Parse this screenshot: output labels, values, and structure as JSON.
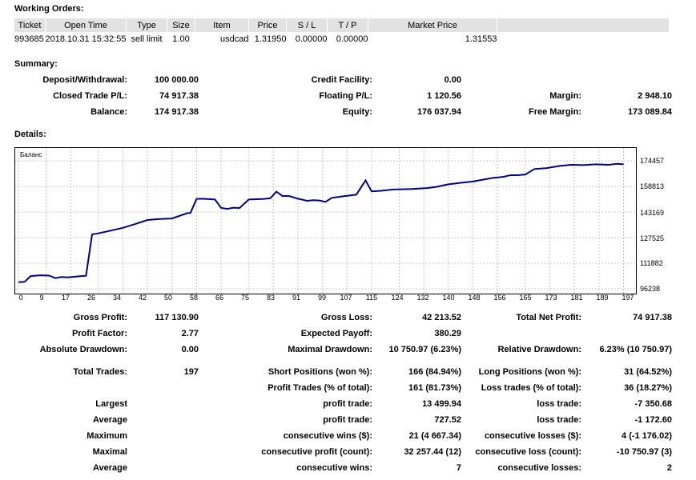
{
  "working_orders": {
    "title": "Working Orders:",
    "headers": [
      "Ticket",
      "Open Time",
      "Type",
      "Size",
      "Item",
      "Price",
      "S / L",
      "T / P",
      "Market Price"
    ],
    "row": [
      "993685",
      "2018.10.31 15:32:55",
      "sell limit",
      "1.00",
      "usdcad",
      "1.31950",
      "0.00000",
      "0.00000",
      "1.31553"
    ]
  },
  "summary": {
    "title": "Summary:",
    "deposit_label": "Deposit/Withdrawal:",
    "deposit_value": "100 000.00",
    "credit_label": "Credit Facility:",
    "credit_value": "0.00",
    "closed_label": "Closed Trade P/L:",
    "closed_value": "74 917.38",
    "floating_label": "Floating P/L:",
    "floating_value": "1 120.56",
    "margin_label": "Margin:",
    "margin_value": "2 948.10",
    "balance_label": "Balance:",
    "balance_value": "174 917.38",
    "equity_label": "Equity:",
    "equity_value": "176 037.94",
    "free_margin_label": "Free Margin:",
    "free_margin_value": "173 089.84"
  },
  "details": {
    "title": "Details:"
  },
  "chart": {
    "legend": "Баланс",
    "line_color": "#000080",
    "y_ticks": [
      "174457",
      "158813",
      "143169",
      "127525",
      "111882",
      "96238"
    ],
    "x_ticks": [
      "0",
      "9",
      "17",
      "26",
      "34",
      "42",
      "50",
      "58",
      "66",
      "75",
      "83",
      "91",
      "99",
      "107",
      "115",
      "124",
      "132",
      "140",
      "148",
      "156",
      "165",
      "173",
      "181",
      "189",
      "197"
    ]
  },
  "chart_data": {
    "type": "line",
    "title": "",
    "xlabel": "",
    "ylabel": "",
    "xlim": [
      0,
      200
    ],
    "ylim": [
      96238,
      174457
    ],
    "grid": true,
    "series": [
      {
        "name": "Баланс",
        "x": [
          0,
          2,
          4,
          7,
          10,
          12,
          14,
          16,
          20,
          22,
          24,
          26,
          30,
          34,
          38,
          42,
          46,
          50,
          55,
          56,
          58,
          60,
          64,
          66,
          68,
          70,
          72,
          75,
          80,
          82,
          84,
          86,
          88,
          91,
          94,
          96,
          98,
          100,
          102,
          106,
          110,
          113,
          115,
          118,
          122,
          128,
          133,
          136,
          140,
          144,
          148,
          154,
          158,
          160,
          163,
          165,
          168,
          172,
          176,
          180,
          184,
          188,
          192,
          195,
          197
        ],
        "y": [
          100300,
          100500,
          104000,
          104500,
          104300,
          102800,
          103400,
          103200,
          103900,
          104200,
          129500,
          130100,
          131800,
          133500,
          135800,
          138300,
          138900,
          139200,
          142500,
          142600,
          151200,
          151300,
          150800,
          145700,
          145100,
          145800,
          145600,
          150800,
          151200,
          151600,
          155600,
          152900,
          153000,
          151300,
          150000,
          150400,
          150200,
          149400,
          151800,
          152800,
          153800,
          162500,
          155800,
          156100,
          156900,
          157200,
          157800,
          158500,
          160100,
          161000,
          161800,
          163900,
          164700,
          165600,
          165700,
          166100,
          169400,
          170000,
          171300,
          172000,
          171800,
          172300,
          172000,
          172600,
          172300
        ]
      }
    ]
  },
  "stats": {
    "gross_profit_label": "Gross Profit:",
    "gross_profit_value": "117 130.90",
    "gross_loss_label": "Gross Loss:",
    "gross_loss_value": "42 213.52",
    "total_net_label": "Total Net Profit:",
    "total_net_value": "74 917.38",
    "profit_factor_label": "Profit Factor:",
    "profit_factor_value": "2.77",
    "expected_label": "Expected Payoff:",
    "expected_value": "380.29",
    "abs_dd_label": "Absolute Drawdown:",
    "abs_dd_value": "0.00",
    "max_dd_label": "Maximal Drawdown:",
    "max_dd_value": "10 750.97 (6.23%)",
    "rel_dd_label": "Relative Drawdown:",
    "rel_dd_value": "6.23% (10 750.97)",
    "total_trades_label": "Total Trades:",
    "total_trades_value": "197",
    "short_label": "Short Positions (won %):",
    "short_value": "166 (84.94%)",
    "long_label": "Long Positions (won %):",
    "long_value": "31 (64.52%)",
    "profit_trades_label": "Profit Trades (% of total):",
    "profit_trades_value": "161 (81.73%)",
    "loss_trades_label": "Loss trades (% of total):",
    "loss_trades_value": "36 (18.27%)",
    "largest_label": "Largest",
    "largest_profit_label": "profit trade:",
    "largest_profit_value": "13 499.94",
    "largest_loss_label": "loss trade:",
    "largest_loss_value": "-7 350.68",
    "average_label": "Average",
    "average_profit_label": "profit trade:",
    "average_profit_value": "727.52",
    "average_loss_label": "loss trade:",
    "average_loss_value": "-1 172.60",
    "maximum_label": "Maximum",
    "max_wins_label": "consecutive wins ($):",
    "max_wins_value": "21 (4 667.34)",
    "max_losses_label": "consecutive losses ($):",
    "max_losses_value": "4 (-1 176.02)",
    "maximal_label": "Maximal",
    "maximal_profit_label": "consecutive profit (count):",
    "maximal_profit_value": "32 257.44 (12)",
    "maximal_loss_label": "consecutive loss (count):",
    "maximal_loss_value": "-10 750.97 (3)",
    "avg2_label": "Average",
    "avg_wins_label": "consecutive wins:",
    "avg_wins_value": "7",
    "avg_losses_label": "consecutive losses:",
    "avg_losses_value": "2"
  }
}
